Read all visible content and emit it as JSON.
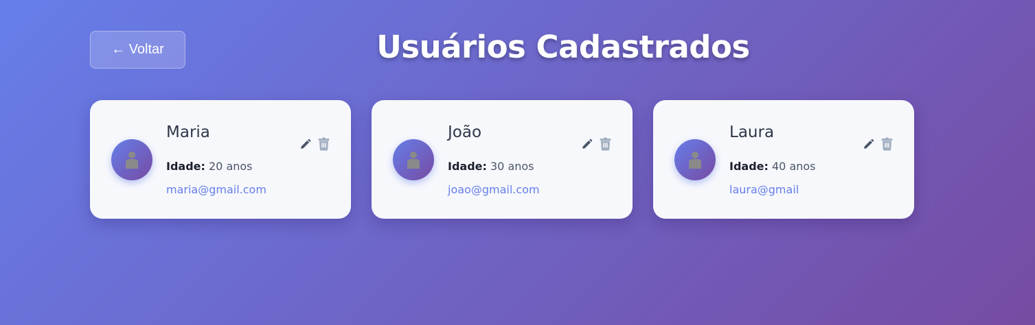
{
  "header": {
    "back_label": "← Voltar",
    "title": "Usuários Cadastrados"
  },
  "users": [
    {
      "name": "Maria",
      "age_label": "Idade:",
      "age_value": " 20 anos",
      "email": "maria@gmail.com"
    },
    {
      "name": "João",
      "age_label": "Idade:",
      "age_value": " 30 anos",
      "email": "joao@gmail.com"
    },
    {
      "name": "Laura",
      "age_label": "Idade:",
      "age_value": " 40 anos",
      "email": "laura@gmail"
    }
  ],
  "icons": {
    "avatar": "person-icon",
    "edit": "pencil-icon",
    "delete": "trash-icon"
  },
  "colors": {
    "gradient_start": "#667eea",
    "gradient_end": "#764ba2",
    "card_background": "#f7f8fc",
    "email_link": "#667eea",
    "edit_icon": "#4a5568",
    "delete_icon": "#a0aec0"
  }
}
